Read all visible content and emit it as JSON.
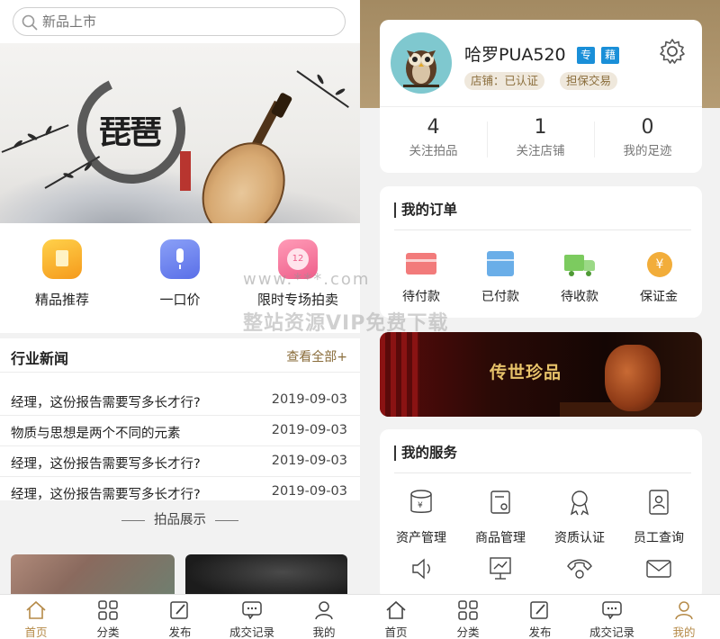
{
  "left": {
    "search": {
      "placeholder": "新品上市"
    },
    "banner": {
      "title": "琵琶"
    },
    "quick_menu": [
      {
        "label": "精品推荐",
        "icon": "recommend-icon",
        "color": "#f7b323"
      },
      {
        "label": "一口价",
        "icon": "microphone-icon",
        "color": "#6b83f0"
      },
      {
        "label": "限时专场拍卖",
        "icon": "clock-icon",
        "color": "#f0779b"
      }
    ],
    "news": {
      "title": "行业新闻",
      "more": "查看全部+",
      "items": [
        {
          "title": "经理，这份报告需要写多长才行?",
          "date": "2019-09-03"
        },
        {
          "title": "物质与思想是两个不同的元素",
          "date": "2019-09-03"
        },
        {
          "title": "经理，这份报告需要写多长才行?",
          "date": "2019-09-03"
        },
        {
          "title": "经理，这份报告需要写多长才行?",
          "date": "2019-09-03"
        }
      ]
    },
    "showcase": {
      "title": "拍品展示"
    },
    "tabbar": [
      {
        "label": "首页",
        "icon": "home-icon",
        "active": true
      },
      {
        "label": "分类",
        "icon": "grid-icon",
        "active": false
      },
      {
        "label": "发布",
        "icon": "edit-icon",
        "active": false
      },
      {
        "label": "成交记录",
        "icon": "chat-icon",
        "active": false
      },
      {
        "label": "我的",
        "icon": "user-icon",
        "active": false
      }
    ]
  },
  "right": {
    "profile": {
      "name": "哈罗PUA520",
      "badges": [
        "专",
        "藉"
      ],
      "tags": [
        "店铺：已认证",
        "担保交易"
      ]
    },
    "stats": [
      {
        "value": "4",
        "label": "关注拍品"
      },
      {
        "value": "1",
        "label": "关注店铺"
      },
      {
        "value": "0",
        "label": "我的足迹"
      }
    ],
    "orders": {
      "title": "我的订单",
      "items": [
        {
          "label": "待付款",
          "icon": "card-icon",
          "color": "#f27b7b"
        },
        {
          "label": "已付款",
          "icon": "box-icon",
          "color": "#6aaee8"
        },
        {
          "label": "待收款",
          "icon": "truck-icon",
          "color": "#7ccb5f"
        },
        {
          "label": "保证金",
          "icon": "coin-icon",
          "color": "#f2ad3a"
        }
      ]
    },
    "promo": {
      "text": "传世珍品"
    },
    "services": {
      "title": "我的服务",
      "items": [
        {
          "label": "资产管理",
          "icon": "wallet-icon"
        },
        {
          "label": "商品管理",
          "icon": "goods-icon"
        },
        {
          "label": "资质认证",
          "icon": "ribbon-icon"
        },
        {
          "label": "员工查询",
          "icon": "id-card-icon"
        },
        {
          "label": "",
          "icon": "speaker-icon"
        },
        {
          "label": "",
          "icon": "chart-icon"
        },
        {
          "label": "",
          "icon": "phone-icon"
        },
        {
          "label": "",
          "icon": "mail-icon"
        }
      ]
    },
    "tabbar": [
      {
        "label": "首页",
        "icon": "home-icon",
        "active": false
      },
      {
        "label": "分类",
        "icon": "grid-icon",
        "active": false
      },
      {
        "label": "发布",
        "icon": "edit-icon",
        "active": false
      },
      {
        "label": "成交记录",
        "icon": "chat-icon",
        "active": false
      },
      {
        "label": "我的",
        "icon": "user-icon",
        "active": true
      }
    ]
  },
  "watermark": {
    "line1": "www.***.com",
    "line2": "整站资源VIP免费下载"
  }
}
